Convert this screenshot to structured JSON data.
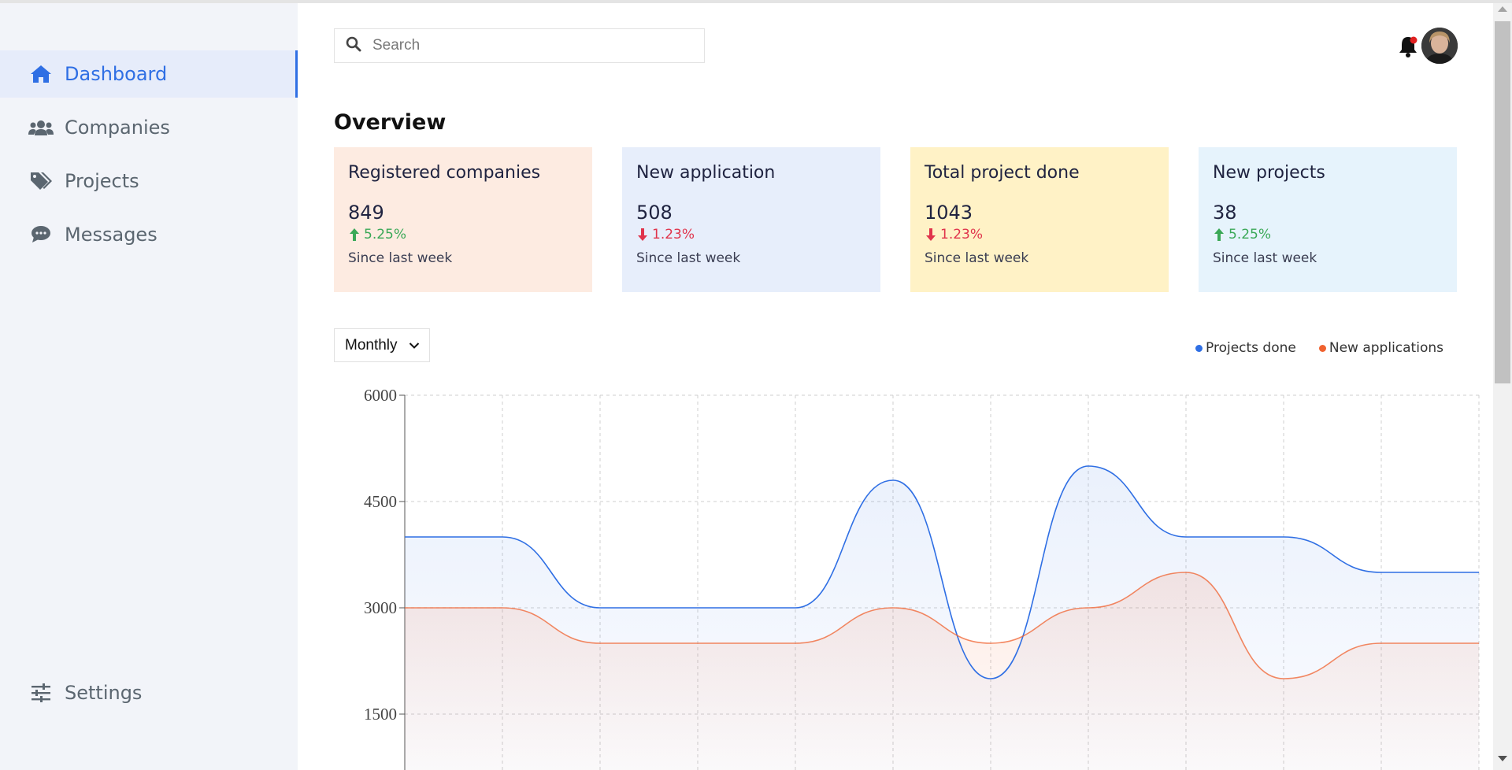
{
  "sidebar": {
    "items": [
      {
        "label": "Dashboard",
        "icon": "home-icon"
      },
      {
        "label": "Companies",
        "icon": "users-icon"
      },
      {
        "label": "Projects",
        "icon": "tags-icon"
      },
      {
        "label": "Messages",
        "icon": "comment-icon"
      }
    ],
    "settings": {
      "label": "Settings",
      "icon": "sliders-icon"
    }
  },
  "header": {
    "search_placeholder": "Search",
    "notification_icon": "bell-icon",
    "notification_dot_color": "#e02020"
  },
  "overview": {
    "title": "Overview",
    "cards": [
      {
        "title": "Registered companies",
        "value": "849",
        "change": "5.25%",
        "direction": "up",
        "since": "Since last week",
        "bg": "#fdebe1"
      },
      {
        "title": "New application",
        "value": "508",
        "change": "1.23%",
        "direction": "down",
        "since": "Since last week",
        "bg": "#e7eefb"
      },
      {
        "title": "Total project done",
        "value": "1043",
        "change": "1.23%",
        "direction": "down",
        "since": "Since last week",
        "bg": "#fff2c6"
      },
      {
        "title": "New projects",
        "value": "38",
        "change": "5.25%",
        "direction": "up",
        "since": "Since last week",
        "bg": "#e6f3fc"
      }
    ]
  },
  "period_select": {
    "value": "Monthly"
  },
  "legend": [
    {
      "label": "Projects done",
      "color": "#2f6fe4"
    },
    {
      "label": "New applications",
      "color": "#f0622f"
    }
  ],
  "chart_data": {
    "type": "area",
    "x": [
      0,
      1,
      2,
      3,
      4,
      5,
      6,
      7,
      8,
      9,
      10,
      11
    ],
    "series": [
      {
        "name": "Projects done",
        "values": [
          4000,
          4000,
          3000,
          3000,
          3000,
          4800,
          2000,
          5000,
          4000,
          4000,
          3500,
          3500
        ],
        "color": "#2f6fe4"
      },
      {
        "name": "New applications",
        "values": [
          3000,
          3000,
          2500,
          2500,
          2500,
          3000,
          2500,
          3000,
          3500,
          2000,
          2500,
          2500
        ],
        "color": "#f0622f"
      }
    ],
    "yticks": [
      "6000",
      "4500",
      "3000",
      "1500"
    ],
    "ylim": [
      0,
      6000
    ],
    "grid": true,
    "legend": "top-right"
  }
}
